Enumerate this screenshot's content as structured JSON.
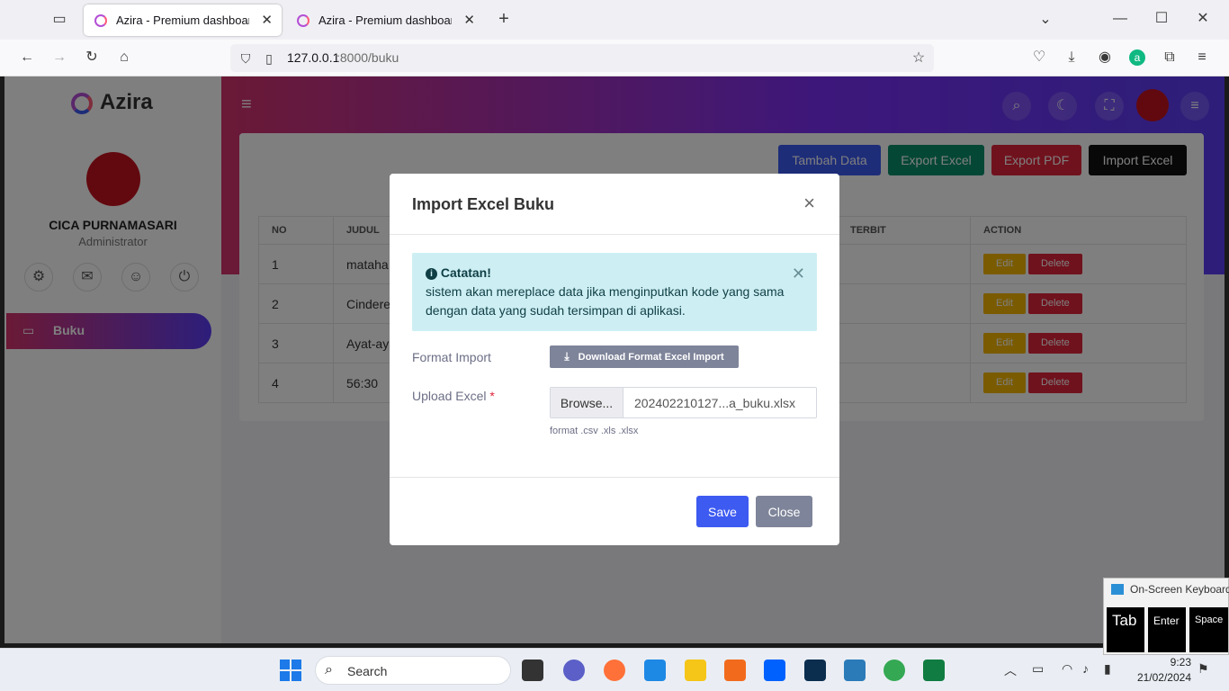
{
  "browser": {
    "tabs": [
      {
        "title": "Azira - Premium dashboard ui b"
      },
      {
        "title": "Azira - Premium dashboard ui b"
      }
    ],
    "url_host": "127.0.0.1",
    "url_rest": ":8000/buku"
  },
  "sidebar": {
    "brand": "Azira",
    "user_name": "CICA PURNAMASARI",
    "user_role": "Administrator",
    "menu_item": "Buku"
  },
  "toolbar": {
    "add": "Tambah Data",
    "export_excel": "Export Excel",
    "export_pdf": "Export PDF",
    "import_excel": "Import Excel"
  },
  "table": {
    "headers": [
      "NO",
      "JUDUL",
      "TERBIT",
      "ACTION"
    ],
    "rows": [
      {
        "no": "1",
        "judul": "mataha"
      },
      {
        "no": "2",
        "judul": "Cindere"
      },
      {
        "no": "3",
        "judul": "Ayat-ay"
      },
      {
        "no": "4",
        "judul": "56:30"
      }
    ],
    "edit": "Edit",
    "delete": "Delete"
  },
  "modal": {
    "title": "Import Excel Buku",
    "alert_title": "Catatan!",
    "alert_text": "sistem akan mereplace data jika menginputkan kode yang sama dengan data yang sudah tersimpan di aplikasi.",
    "format_label": "Format Import",
    "download_button": "Download Format Excel Import",
    "upload_label": "Upload Excel",
    "required_mark": "*",
    "browse": "Browse...",
    "filename": "202402210127...a_buku.xlsx",
    "hint": "format .csv .xls .xlsx",
    "save": "Save",
    "close": "Close"
  },
  "taskbar": {
    "search": "Search",
    "time": "9:23",
    "date": "21/02/2024"
  },
  "osk": {
    "title": "On-Screen Keyboard",
    "keys": [
      "Tab",
      "Enter",
      "Space"
    ]
  },
  "colors": {
    "primary": "#3d5af1",
    "export_excel": "#0b8f6a",
    "export_pdf": "#e0243b",
    "edit": "#f5b700",
    "delete": "#e0243b",
    "alert_bg": "#cdeff3"
  }
}
